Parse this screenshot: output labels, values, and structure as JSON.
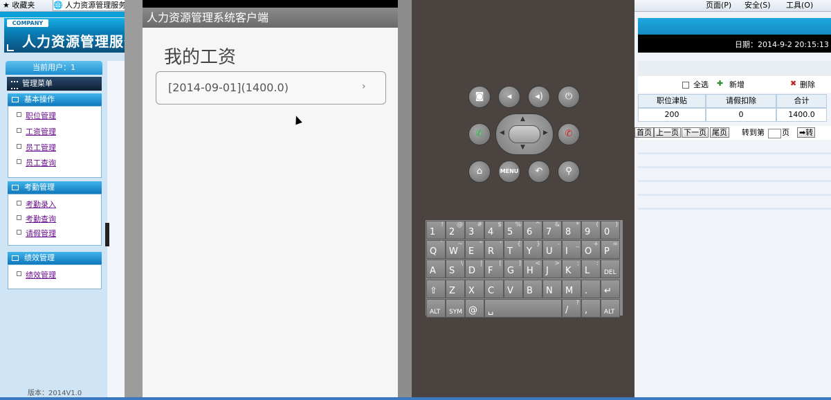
{
  "browser": {
    "favorites_label": "收藏夹",
    "tab_label": "人力资源管理服务",
    "menu_items": [
      "页面(P)",
      "安全(S)",
      "工具(O)"
    ]
  },
  "website": {
    "company_badge": "COMPANY",
    "system_title": "人力资源管理服务",
    "current_user_label": "当前用户：1",
    "management_menu_label": "管理菜单",
    "sections": [
      {
        "title": "基本操作",
        "items": [
          "职位管理",
          "工资管理",
          "员工管理",
          "员工查询"
        ]
      },
      {
        "title": "考勤管理",
        "items": [
          "考勤录入",
          "考勤查询",
          "请假管理"
        ]
      },
      {
        "title": "绩效管理",
        "items": [
          "绩效管理"
        ]
      }
    ],
    "version": "版本：2014V1.0",
    "date_label": "日期：2014-9-2 20:15:13",
    "toolbar": {
      "select_all": "全选",
      "add": "新增",
      "delete": "删除"
    },
    "table": {
      "headers": [
        "职位津贴",
        "请假扣除",
        "合计"
      ],
      "row": [
        "200",
        "0",
        "1400.0"
      ]
    },
    "pager": {
      "first": "首页",
      "prev": "上一页",
      "next": "下一页",
      "last": "尾页",
      "goto_prefix": "转到第",
      "goto_suffix": "页",
      "go_button": "➡转"
    }
  },
  "phone": {
    "app_title": "人力资源管理系统客户端",
    "screen_heading": "我的工资",
    "salary_entries": [
      "[2014-09-01](1400.0)"
    ]
  },
  "keyboard": {
    "rows": [
      [
        [
          "1",
          "!"
        ],
        [
          "2",
          "@"
        ],
        [
          "3",
          "#"
        ],
        [
          "4",
          "$"
        ],
        [
          "5",
          "%"
        ],
        [
          "6",
          "^"
        ],
        [
          "7",
          "&"
        ],
        [
          "8",
          "*"
        ],
        [
          "9",
          "("
        ],
        [
          "0",
          ")"
        ]
      ],
      [
        [
          "Q",
          "`"
        ],
        [
          "W",
          "~"
        ],
        [
          "E",
          "\""
        ],
        [
          "R",
          "'"
        ],
        [
          "T",
          "{"
        ],
        [
          "Y",
          "}"
        ],
        [
          "U",
          "-"
        ],
        [
          "I",
          "_"
        ],
        [
          "O",
          "+"
        ],
        [
          "P",
          "="
        ]
      ],
      [
        [
          "A",
          ""
        ],
        [
          "S",
          "\\"
        ],
        [
          "D",
          "|"
        ],
        [
          "F",
          "["
        ],
        [
          "G",
          "]"
        ],
        [
          "H",
          "<"
        ],
        [
          "J",
          ">"
        ],
        [
          "K",
          ";"
        ],
        [
          "L",
          ":"
        ],
        [
          "DEL",
          ""
        ]
      ],
      [
        [
          "⇧",
          ""
        ],
        [
          "Z",
          ""
        ],
        [
          "X",
          ""
        ],
        [
          "C",
          ""
        ],
        [
          "V",
          ""
        ],
        [
          "B",
          ""
        ],
        [
          "N",
          ""
        ],
        [
          "M",
          ""
        ],
        [
          ".",
          ""
        ],
        [
          "↵",
          ""
        ]
      ],
      [
        [
          "ALT",
          ""
        ],
        [
          "SYM",
          ""
        ],
        [
          "@",
          ""
        ],
        [
          "␣",
          ""
        ],
        [
          "/",
          "?"
        ],
        [
          ",",
          ""
        ],
        [
          "ALT",
          ""
        ]
      ]
    ]
  },
  "emulator_buttons": {
    "row1": [
      "camera-icon",
      "volume-down-icon",
      "volume-up-icon",
      "power-icon"
    ],
    "row2": [
      "call-icon",
      "end-call-icon"
    ],
    "row3": [
      "home-icon",
      "menu-label",
      "back-icon",
      "search-icon"
    ],
    "menu_label": "MENU"
  },
  "colors": {
    "web_header": "#0d9fd8",
    "link": "#6a0f8e",
    "emulator_panel": "#4a4340",
    "phone_title_bar": "#7a7a7a"
  }
}
